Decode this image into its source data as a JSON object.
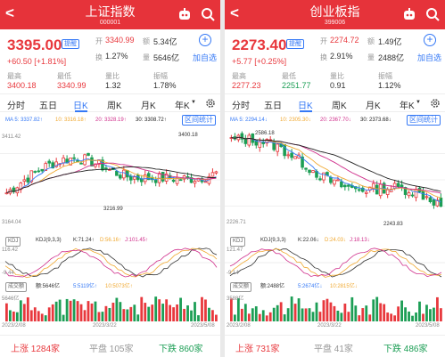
{
  "panels": [
    {
      "header": {
        "title": "上证指数",
        "code": "000001"
      },
      "quote": {
        "price": "3395.00",
        "reminder": "提醒",
        "change": "+60.50",
        "change_pct": "[+1.81%]",
        "add_label": "加自选",
        "row_labels": {
          "open": "开",
          "amount": "额",
          "turnover": "换",
          "volume": "量",
          "high": "最高",
          "low": "最低",
          "volume_ratio": "量比",
          "amplitude": "振幅"
        },
        "open": "3340.99",
        "amount": "5.34亿",
        "turnover": "1.27%",
        "volume": "5646亿",
        "high": "3400.18",
        "low": "3340.99",
        "volume_ratio": "1.32",
        "amplitude": "1.78%"
      },
      "tabs": [
        "分时",
        "五日",
        "日K",
        "周K",
        "月K",
        "年K"
      ],
      "active_tab": 2,
      "ma": {
        "ma5": "MA 5: 3337.82↑",
        "ma10": "10: 3316.18↑",
        "ma20": "20: 3328.19↑",
        "ma30": "30: 3308.72↑"
      },
      "interval_stats": "区间统计",
      "axis": {
        "top": "3411.42",
        "bottom": "3164.04"
      },
      "markers": {
        "high": "3400.18",
        "low": "3216.99"
      },
      "kdj": {
        "box": "KDJ",
        "params": "KDJ(9,3,3)",
        "k": "K:71.24↑",
        "d": "D:56.16↑",
        "j": "J:101.45↑",
        "top": "116.42",
        "bottom": "-9.44"
      },
      "volume": {
        "box": "成交额",
        "total": "额:5646亿",
        "m5": "5:5119亿↑",
        "m10": "10:5073亿↑",
        "top": "5646亿"
      },
      "dates": [
        "2023/2/08",
        "2023/3/22",
        "2023/5/08"
      ],
      "market": {
        "up_label": "上涨",
        "up_count": "1284家",
        "flat_label": "平盘",
        "flat_count": "105家",
        "down_label": "下跌",
        "down_count": "860家"
      }
    },
    {
      "header": {
        "title": "创业板指",
        "code": "399006"
      },
      "quote": {
        "price": "2273.40",
        "reminder": "提醒",
        "change": "+5.77",
        "change_pct": "[+0.25%]",
        "add_label": "加自选",
        "row_labels": {
          "open": "开",
          "amount": "额",
          "turnover": "换",
          "volume": "量",
          "high": "最高",
          "low": "最低",
          "volume_ratio": "量比",
          "amplitude": "振幅"
        },
        "open": "2274.72",
        "amount": "1.49亿",
        "turnover": "2.91%",
        "volume": "2488亿",
        "high": "2277.23",
        "low": "2251.77",
        "volume_ratio": "0.91",
        "amplitude": "1.12%"
      },
      "tabs": [
        "分时",
        "五日",
        "日K",
        "周K",
        "月K",
        "年K"
      ],
      "active_tab": 2,
      "ma": {
        "ma5": "MA 5: 2294.14↓",
        "ma10": "10: 2305.30↓",
        "ma20": "20: 2367.70↓",
        "ma30": "30: 2373.68↓"
      },
      "interval_stats": "区间统计",
      "axis": {
        "top": "",
        "bottom": "2226.71"
      },
      "markers": {
        "high": "2586.18",
        "low": "2243.83"
      },
      "kdj": {
        "box": "KDJ",
        "params": "KDJ(9,3,3)",
        "k": "K:22.06↓",
        "d": "D:24.03↓",
        "j": "J:18.13↓",
        "top": "121.47",
        "bottom": "-9.14"
      },
      "volume": {
        "box": "成交额",
        "total": "额:2488亿",
        "m5": "5:2674亿↓",
        "m10": "10:2815亿↓",
        "top": "3588亿"
      },
      "dates": [
        "2023/2/08",
        "2023/3/22",
        "2023/5/08"
      ],
      "market": {
        "up_label": "上涨",
        "up_count": "731家",
        "flat_label": "平盘",
        "flat_count": "41家",
        "down_label": "下跌",
        "down_count": "486家"
      }
    }
  ],
  "colors": {
    "brand": "#e6333a",
    "up": "#e8383d",
    "down": "#1c9e55",
    "accent": "#3478f6",
    "ma5": "#3478f6",
    "ma10": "#f0a830",
    "ma20": "#d0308c",
    "ma30": "#222222"
  },
  "icons": [
    "back-arrow-icon",
    "robot-icon",
    "search-icon",
    "plus-circle-icon",
    "gear-icon"
  ]
}
